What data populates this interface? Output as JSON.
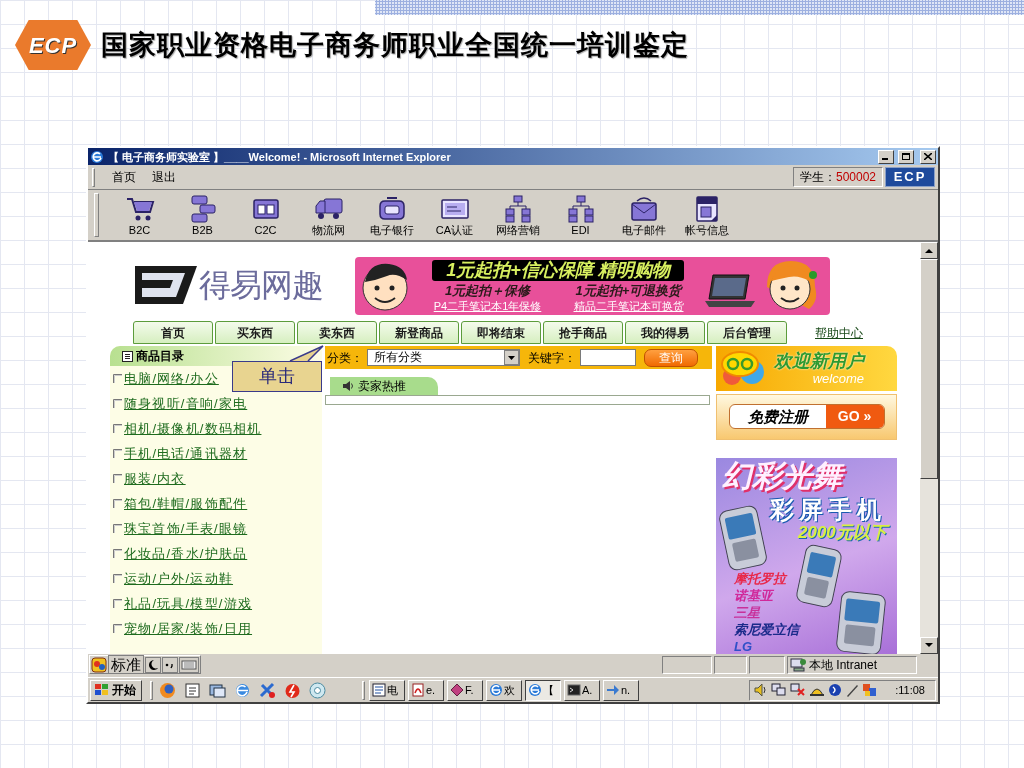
{
  "slide": {
    "logo": "ECP",
    "title": "国家职业资格电子商务师职业全国统一培训鉴定"
  },
  "window": {
    "title": "【 电子商务师实验室 】____Welcome! - Microsoft Internet Explorer",
    "menu": [
      "首页",
      "退出"
    ],
    "student_label": "学生：",
    "student_id": "500002",
    "brand": "ECP",
    "toolbar": [
      {
        "label": "B2C",
        "kind": "cart"
      },
      {
        "label": "B2B",
        "kind": "servers"
      },
      {
        "label": "C2C",
        "kind": "folders"
      },
      {
        "label": "物流网",
        "kind": "truck"
      },
      {
        "label": "电子银行",
        "kind": "wallet"
      },
      {
        "label": "CA认证",
        "kind": "card"
      },
      {
        "label": "网络营销",
        "kind": "network"
      },
      {
        "label": "EDI",
        "kind": "network"
      },
      {
        "label": "电子邮件",
        "kind": "mail"
      },
      {
        "label": "帐号信息",
        "kind": "help"
      }
    ]
  },
  "page": {
    "logo": "得易网趣",
    "banner": {
      "headline": "1元起拍+信心保障 精明购物",
      "offers": [
        {
          "title": "1元起拍＋保修",
          "link": "P4二手笔记本1年保修"
        },
        {
          "title": "1元起拍+可退换货",
          "link": "精品二手笔记本可换货"
        }
      ]
    },
    "nav_tabs": [
      "首页",
      "买东西",
      "卖东西",
      "新登商品",
      "即将结束",
      "抢手商品",
      "我的得易",
      "后台管理"
    ],
    "help_link": "帮助中心",
    "categories": {
      "heading": "商品目录",
      "items": [
        "电脑/网络/办公",
        "随身视听/音响/家电",
        "相机/摄像机/数码相机",
        "手机/电话/通讯器材",
        "服装/内衣",
        "箱包/鞋帽/服饰配件",
        "珠宝首饰/手表/眼镜",
        "化妆品/香水/护肤品",
        "运动/户外/运动鞋",
        "礼品/玩具/模型/游戏",
        "宠物/居家/装饰/日用"
      ]
    },
    "callout": "单击",
    "search": {
      "category_label": "分类：",
      "category_value": "所有分类",
      "keyword_label": "关键字：",
      "button": "查询"
    },
    "section_tab": "卖家热推",
    "welcome": {
      "title": "欢迎新用户",
      "subtitle": "welcome"
    },
    "register": {
      "label": "免费注册",
      "go": "GO »"
    },
    "ad": {
      "title": "幻彩光舞",
      "headline": "彩屏手机",
      "price": "2000元以下",
      "brands": [
        {
          "name": "摩托罗拉",
          "color": "#e8284a"
        },
        {
          "name": "诺基亚",
          "color": "#d0289a"
        },
        {
          "name": "三星",
          "color": "#c8309a"
        },
        {
          "name": "索尼爱立信",
          "color": "#1a2a8a"
        },
        {
          "name": "LG",
          "color": "#3050c8"
        }
      ]
    }
  },
  "status_bar": {
    "ime": "标准",
    "zone": "本地 Intranet"
  },
  "taskbar": {
    "start": "开始",
    "tasks": [
      {
        "label": "电",
        "kind": "document",
        "selected": false
      },
      {
        "label": "e.",
        "kind": "pdf",
        "selected": false
      },
      {
        "label": "F.",
        "kind": "diamond",
        "selected": false
      },
      {
        "label": "欢",
        "kind": "browser",
        "selected": false
      },
      {
        "label": "【",
        "kind": "browser",
        "selected": true
      },
      {
        "label": "A.",
        "kind": "terminal",
        "selected": false
      },
      {
        "label": "n.",
        "kind": "arrow",
        "selected": false
      }
    ],
    "clock": ":11:08"
  }
}
